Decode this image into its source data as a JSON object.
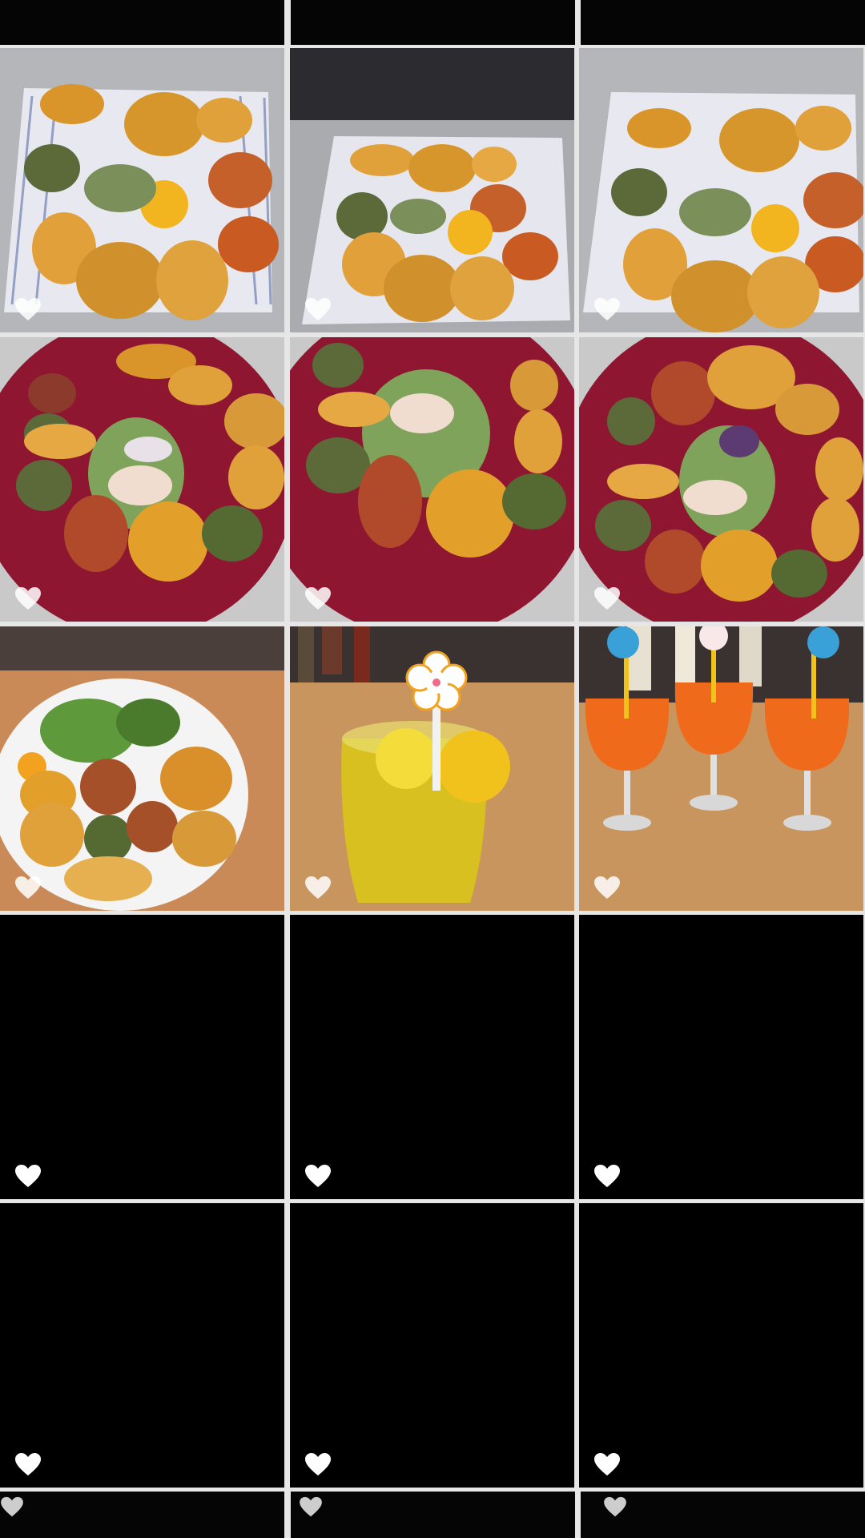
{
  "grid": {
    "columns": 3,
    "background": "#e6e6e6",
    "tiles": [
      {
        "row": 1,
        "col": 1,
        "content": "pakora-platter-square-plate",
        "like_icon": "heart-icon"
      },
      {
        "row": 1,
        "col": 2,
        "content": "pakora-platter-square-plate",
        "like_icon": "heart-icon"
      },
      {
        "row": 1,
        "col": 3,
        "content": "pakora-platter-square-plate",
        "like_icon": "heart-icon"
      },
      {
        "row": 2,
        "col": 1,
        "content": "pakora-platter-red-plate",
        "like_icon": "heart-icon"
      },
      {
        "row": 2,
        "col": 2,
        "content": "pakora-platter-red-plate",
        "like_icon": "heart-icon"
      },
      {
        "row": 2,
        "col": 3,
        "content": "pakora-platter-red-plate",
        "like_icon": "heart-icon"
      },
      {
        "row": 3,
        "col": 1,
        "content": "pakora-white-plate",
        "like_icon": "heart-icon"
      },
      {
        "row": 3,
        "col": 2,
        "content": "lemon-drink-glass",
        "like_icon": "heart-icon"
      },
      {
        "row": 3,
        "col": 3,
        "content": "three-orange-drinks",
        "like_icon": "heart-icon"
      },
      {
        "row": 4,
        "col": 1,
        "content": "blank",
        "like_icon": "heart-icon"
      },
      {
        "row": 4,
        "col": 2,
        "content": "blank",
        "like_icon": "heart-icon"
      },
      {
        "row": 4,
        "col": 3,
        "content": "blank",
        "like_icon": "heart-icon"
      },
      {
        "row": 5,
        "col": 1,
        "content": "blank",
        "like_icon": "heart-icon"
      },
      {
        "row": 5,
        "col": 2,
        "content": "blank",
        "like_icon": "heart-icon"
      },
      {
        "row": 5,
        "col": 3,
        "content": "blank",
        "like_icon": "heart-icon"
      }
    ]
  },
  "colors": {
    "heart": "#ffffff",
    "tile_blank": "#000000",
    "pakora": "#d9952a",
    "plate_red": "#8e1630",
    "drink_orange": "#f06a1c",
    "drink_yellow": "#d8c21c"
  }
}
